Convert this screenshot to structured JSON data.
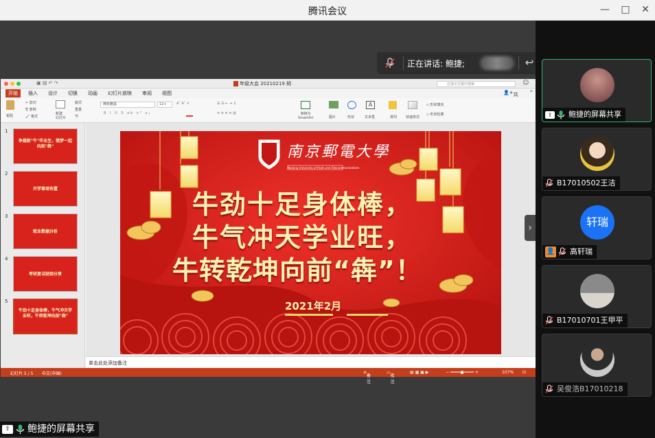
{
  "app": {
    "title": "腾讯会议"
  },
  "speaking": {
    "label": "正在讲话: 鲍捷;"
  },
  "ppt": {
    "doc_title": "年级大会 20210219 鸫",
    "search_placeholder": "在演示文稿中搜索",
    "share_label": "共享",
    "menu": [
      "开始",
      "插入",
      "设计",
      "切换",
      "动画",
      "幻灯片放映",
      "审阅",
      "视图"
    ],
    "ribbon": {
      "paste": "粘贴",
      "cut": "剪切",
      "copy": "复制",
      "format": "格式",
      "new_slide": "新建\n幻灯片",
      "layout": "版式",
      "reset": "重置",
      "section": "节",
      "font_name": "微软雅黑",
      "font_size": "12+",
      "convert_smartart": "转换为\nSmartArt",
      "picture": "图片",
      "shape": "形状",
      "textbox": "文本框",
      "arrange": "排列",
      "quick_styles": "快速样式",
      "shape_fill": "形状填充",
      "shape_outline": "形状轮廓"
    },
    "thumbnails": [
      {
        "num": "1",
        "text": "争做新\"牛\"毕业生，携梦一起向前\"犇\""
      },
      {
        "num": "2",
        "text": "开学事项布置"
      },
      {
        "num": "3",
        "text": "就业数据分析"
      },
      {
        "num": "4",
        "text": "考研复试经验分享"
      },
      {
        "num": "5",
        "text": "牛劲十足身体棒，牛气冲天学业旺，牛转乾坤向前\"犇\""
      }
    ],
    "slide": {
      "university": "南京郵電大學",
      "university_en": "Nanjing University of Posts and Telecommunications",
      "line1": "牛劲十足身体棒，",
      "line2": "牛气冲天学业旺，",
      "line3": "牛转乾坤向前“犇”！",
      "date": "2021年2月"
    },
    "notes_placeholder": "单击此处添加备注",
    "status": {
      "slide_info": "幻灯片 5 / 5",
      "language": "中文(中国)",
      "notes": "备注",
      "comments": "批注",
      "zoom": "107%"
    }
  },
  "participants": [
    {
      "name": "鲍捷的屏幕共享",
      "avatar_text": ""
    },
    {
      "name": "B17010502王洁",
      "avatar_text": ""
    },
    {
      "name": "高轩瑞",
      "avatar_text": "轩瑞"
    },
    {
      "name": "B17010701王甲平",
      "avatar_text": ""
    },
    {
      "name": "吴俊浩B17010218",
      "avatar_text": ""
    }
  ],
  "bottom_label": "鲍捷的屏幕共享",
  "colors": {
    "accent": "#2fb66f",
    "ppt_red": "#c43e1c",
    "slide_red": "#d61f1b",
    "gold": "#ffe7a0",
    "avatar_blue": "#1a73f5"
  }
}
